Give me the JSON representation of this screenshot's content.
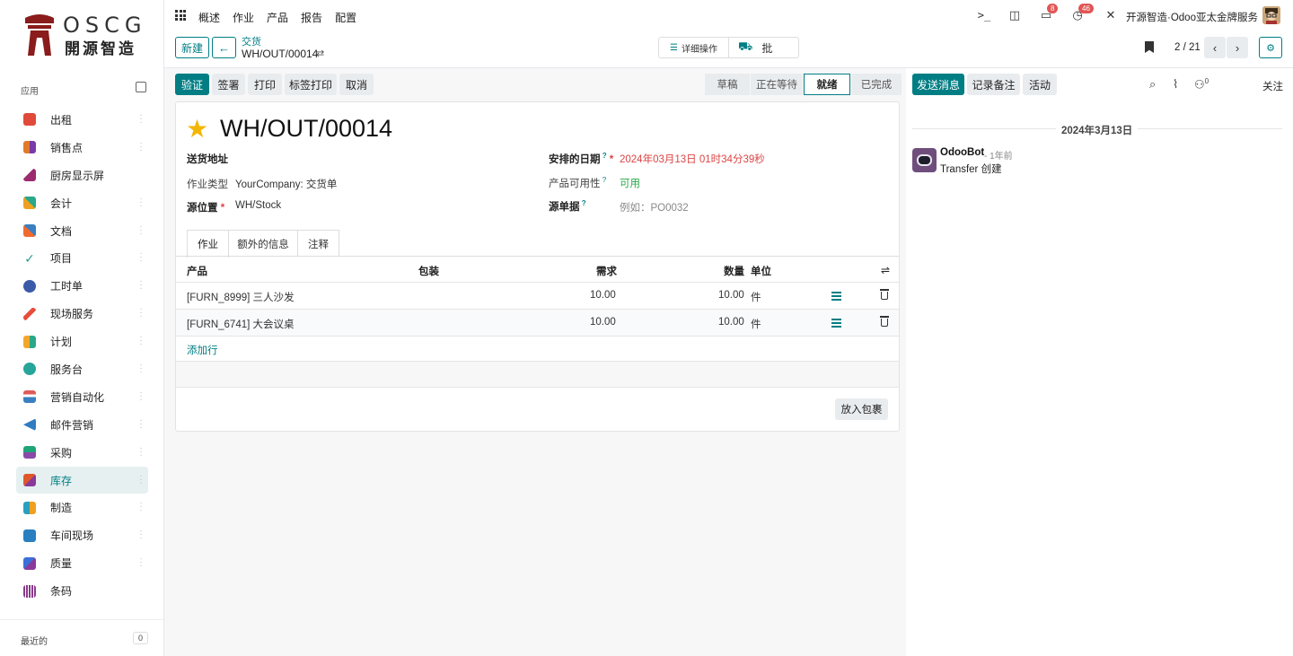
{
  "sidebar": {
    "logo_text": "OSCG",
    "logo_subtext": "開源智造",
    "apps_heading": "应用",
    "apps": [
      {
        "label": "出租",
        "color": "#e04a3a"
      },
      {
        "label": "销售点",
        "color": "#e07b2a"
      },
      {
        "label": "厨房显示屏",
        "color": "#9b2b6e"
      },
      {
        "label": "会计",
        "color": "#f0a020"
      },
      {
        "label": "文档",
        "color": "#f06a30"
      },
      {
        "label": "项目",
        "color": "#2a9d8f"
      },
      {
        "label": "工时单",
        "color": "#3a5ba8"
      },
      {
        "label": "现场服务",
        "color": "#e74c3c"
      },
      {
        "label": "计划",
        "color": "#f4a62a"
      },
      {
        "label": "服务台",
        "color": "#27a59a"
      },
      {
        "label": "营销自动化",
        "color": "#e05a5a"
      },
      {
        "label": "邮件营销",
        "color": "#2f7cc0"
      },
      {
        "label": "采购",
        "color": "#1fa47a"
      },
      {
        "label": "库存",
        "color": "#e0582a"
      },
      {
        "label": "制造",
        "color": "#2a9fc0"
      },
      {
        "label": "车间现场",
        "color": "#2a7fc0"
      },
      {
        "label": "质量",
        "color": "#3a6fd8"
      },
      {
        "label": "条码",
        "color": "#8b3a8b"
      }
    ],
    "active_app": "库存",
    "recent_label": "最近的",
    "recent_count": "0"
  },
  "topnav": {
    "menus": [
      "概述",
      "作业",
      "产品",
      "报告",
      "配置"
    ],
    "messages_badge": "8",
    "activity_badge": "46",
    "company": "开源智造·Odoo亚太金牌服务"
  },
  "control": {
    "new_button": "新建",
    "breadcrumb_parent": "交货",
    "breadcrumb_current": "WH/OUT/00014",
    "detail_ops": "详细操作",
    "batch": "批",
    "pager": "2 / 21"
  },
  "actions": {
    "validate": "验证",
    "sign": "签署",
    "print": "打印",
    "label_print": "标签打印",
    "cancel": "取消"
  },
  "status_stages": [
    "草稿",
    "正在等待",
    "就绪",
    "已完成"
  ],
  "current_stage": "就绪",
  "record": {
    "title": "WH/OUT/00014",
    "delivery_address_label": "送货地址",
    "operation_type_label": "作业类型",
    "operation_type_value": "YourCompany: 交货单",
    "source_location_label": "源位置",
    "source_location_value": "WH/Stock",
    "scheduled_date_label": "安排的日期",
    "scheduled_date_value": "2024年03月13日 01时34分39秒",
    "availability_label": "产品可用性",
    "availability_value": "可用",
    "source_doc_label": "源单据",
    "source_doc_placeholder": "例如：PO0032"
  },
  "tabs": [
    "作业",
    "额外的信息",
    "注释"
  ],
  "operations": {
    "headers": {
      "product": "产品",
      "packaging": "包装",
      "demand": "需求",
      "quantity": "数量",
      "unit": "单位"
    },
    "rows": [
      {
        "product": "[FURN_8999] 三人沙发",
        "demand": "10.00",
        "quantity": "10.00",
        "unit": "件"
      },
      {
        "product": "[FURN_6741] 大会议桌",
        "demand": "10.00",
        "quantity": "10.00",
        "unit": "件"
      }
    ],
    "add_line": "添加行",
    "put_in_pack": "放入包裹"
  },
  "chatter": {
    "send_message": "发送消息",
    "log_note": "记录备注",
    "activity": "活动",
    "followers_count": "0",
    "follow": "关注",
    "date_separator": "2024年3月13日",
    "messages": [
      {
        "author": "OdooBot",
        "time": "- 1年前",
        "body": "Transfer 创建"
      }
    ]
  },
  "colors": {
    "brand": "#017e84",
    "danger": "#d44",
    "success": "#28a745"
  }
}
